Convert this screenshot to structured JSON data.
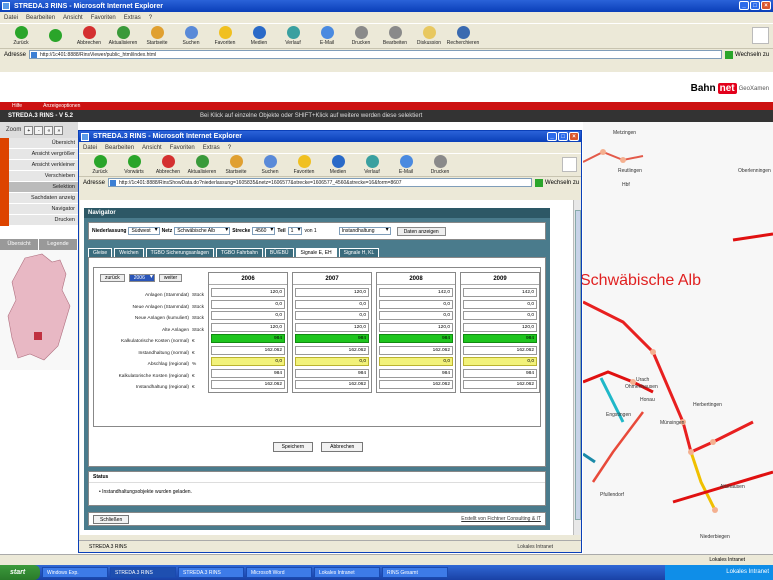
{
  "outer": {
    "title": "STREDA.3 RINS - Microsoft Internet Explorer",
    "menu": [
      "Datei",
      "Bearbeiten",
      "Ansicht",
      "Favoriten",
      "Extras",
      "?"
    ],
    "toolbar": [
      "Zurück",
      "",
      "Abbrechen",
      "Aktualisieren",
      "Startseite",
      "Suchen",
      "Favoriten",
      "Medien",
      "Verlauf",
      "E-Mail",
      "Drucken",
      "Bearbeiten",
      "Diskussion",
      "Recherchieren"
    ],
    "address_label": "Adresse",
    "address": "http://1c401:8888/RinsViewer/public_html/index.html",
    "go_label": "Wechseln zu",
    "redbar": [
      "Hilfe",
      "Anzeigeoptionen"
    ],
    "version": "STREDA.3 RINS - V 5.2",
    "message": "Bei Klick auf einzelne Objekte oder SHIFT+Klick auf weitere werden diese selektiert",
    "zoom_label": "Zoom",
    "zoom_buttons": [
      "+",
      "-",
      "«",
      "»"
    ],
    "logo": {
      "bahn": "Bahn",
      "net": "net",
      "geo": "GeoXamen"
    },
    "nav": [
      "Übersicht",
      "Ansicht vergrößer",
      "Ansicht verkleiner",
      "Verschieben",
      "Selektion",
      "Sachdaten anzeig",
      "Navigator",
      "Drucken"
    ],
    "overview_tabs": [
      "Übersicht",
      "Legende"
    ],
    "map_label": "Schwäbische Alb",
    "map_places": [
      "Metzingen",
      "Oberlenningen",
      "Reutlingen",
      "Hbf",
      "Urach",
      "Ohmenhausen",
      "Honau",
      "Engstingen",
      "Herbertingen",
      "Münsingen",
      "Pfullendorf",
      "Altshausen",
      "Niederbiegen"
    ],
    "status_zone": "Lokales Intranet"
  },
  "inner": {
    "title": "STREDA.3 RINS - Microsoft Internet Explorer",
    "menu": [
      "Datei",
      "Bearbeiten",
      "Ansicht",
      "Favoriten",
      "Extras",
      "?"
    ],
    "toolbar": [
      "Zurück",
      "Vorwärts",
      "Abbrechen",
      "Aktualisieren",
      "Startseite",
      "Suchen",
      "Favoriten",
      "Medien",
      "Verlauf",
      "E-Mail",
      "Drucken"
    ],
    "address_label": "Adresse",
    "address": "http://1c401:8888/RinsShowData.do?niederlassung=1605835&netz=1606577&strecke=1606577_4560&strecke=16&form=8607",
    "go_label": "Wechseln zu",
    "status_left": "STREDA.3 RINS",
    "status_zone": "Lokales Intranet",
    "navigator": {
      "title": "Navigator",
      "niederlassung_label": "Niederlassung",
      "niederlassung_value": "Südwest",
      "netz_label": "Netz",
      "netz_value": "Schwäbische Alb",
      "strecke_label": "Strecke",
      "strecke_value": "4560",
      "teil_label": "Teil",
      "teil_value": "1",
      "teil_von": "von 1",
      "mode_value": "Instandhaltung",
      "show_button": "Daten anzeigen",
      "tabs": [
        "Gleise",
        "Weichen",
        "TGBO Sicherungsanlagen",
        "TGBO Fahrbahn",
        "BÜ/EBÜ",
        "Signale E, EH",
        "Signale H, KL"
      ],
      "active_tab": "Signale E, EH",
      "prev_button": "zurück",
      "year_select": "2006",
      "next_button": "weiter",
      "rows": [
        {
          "label": "Anlagen (Stammdat)",
          "unit": "Stück"
        },
        {
          "label": "Neue Anlagen (Stammdat)",
          "unit": "Stück"
        },
        {
          "label": "Neue Anlagen (kumuliert)",
          "unit": "Stück"
        },
        {
          "label": "Alte Anlagen",
          "unit": "Stück"
        },
        {
          "label": "Kalkulatorische Kosten (normal)",
          "unit": "€"
        },
        {
          "label": "Instandhaltung (normal)",
          "unit": "€"
        },
        {
          "label": "Abschlag (regional)",
          "unit": "%"
        },
        {
          "label": "Kalkulatorische Kosten (regional)",
          "unit": "€"
        },
        {
          "label": "Instandhaltung (regional)",
          "unit": "€"
        }
      ],
      "years": [
        {
          "year": "2006",
          "values": [
            "120,0",
            "0,0",
            "0,0",
            "120,0",
            "984",
            "162.062",
            "0,0",
            "984",
            "162.062"
          ]
        },
        {
          "year": "2007",
          "values": [
            "120,0",
            "0,0",
            "0,0",
            "120,0",
            "984",
            "162.062",
            "0,0",
            "984",
            "162.062"
          ]
        },
        {
          "year": "2008",
          "values": [
            "142,0",
            "0,0",
            "0,0",
            "120,0",
            "984",
            "162.062",
            "0,0",
            "984",
            "162.062"
          ]
        },
        {
          "year": "2009",
          "values": [
            "142,0",
            "0,0",
            "0,0",
            "120,0",
            "984",
            "162.062",
            "0,0",
            "984",
            "162.062"
          ]
        }
      ],
      "save_button": "Speichern",
      "cancel_button": "Abbrechen",
      "status_title": "Status",
      "status_message": "Instandhaltungsobjekte wurden geladen.",
      "close_button": "Schließen",
      "credit": "Erstellt von Fichtner Consulting & IT"
    }
  },
  "taskbar": {
    "start": "start",
    "tasks": [
      "Windows Exp.",
      "STREDA.3 RINS",
      "STREDA.3 RINS",
      "Microsoft Word",
      "Lokales Intranet",
      "RINS Gesamt"
    ],
    "active_index": 1,
    "zone": "Lokales Intranet"
  }
}
